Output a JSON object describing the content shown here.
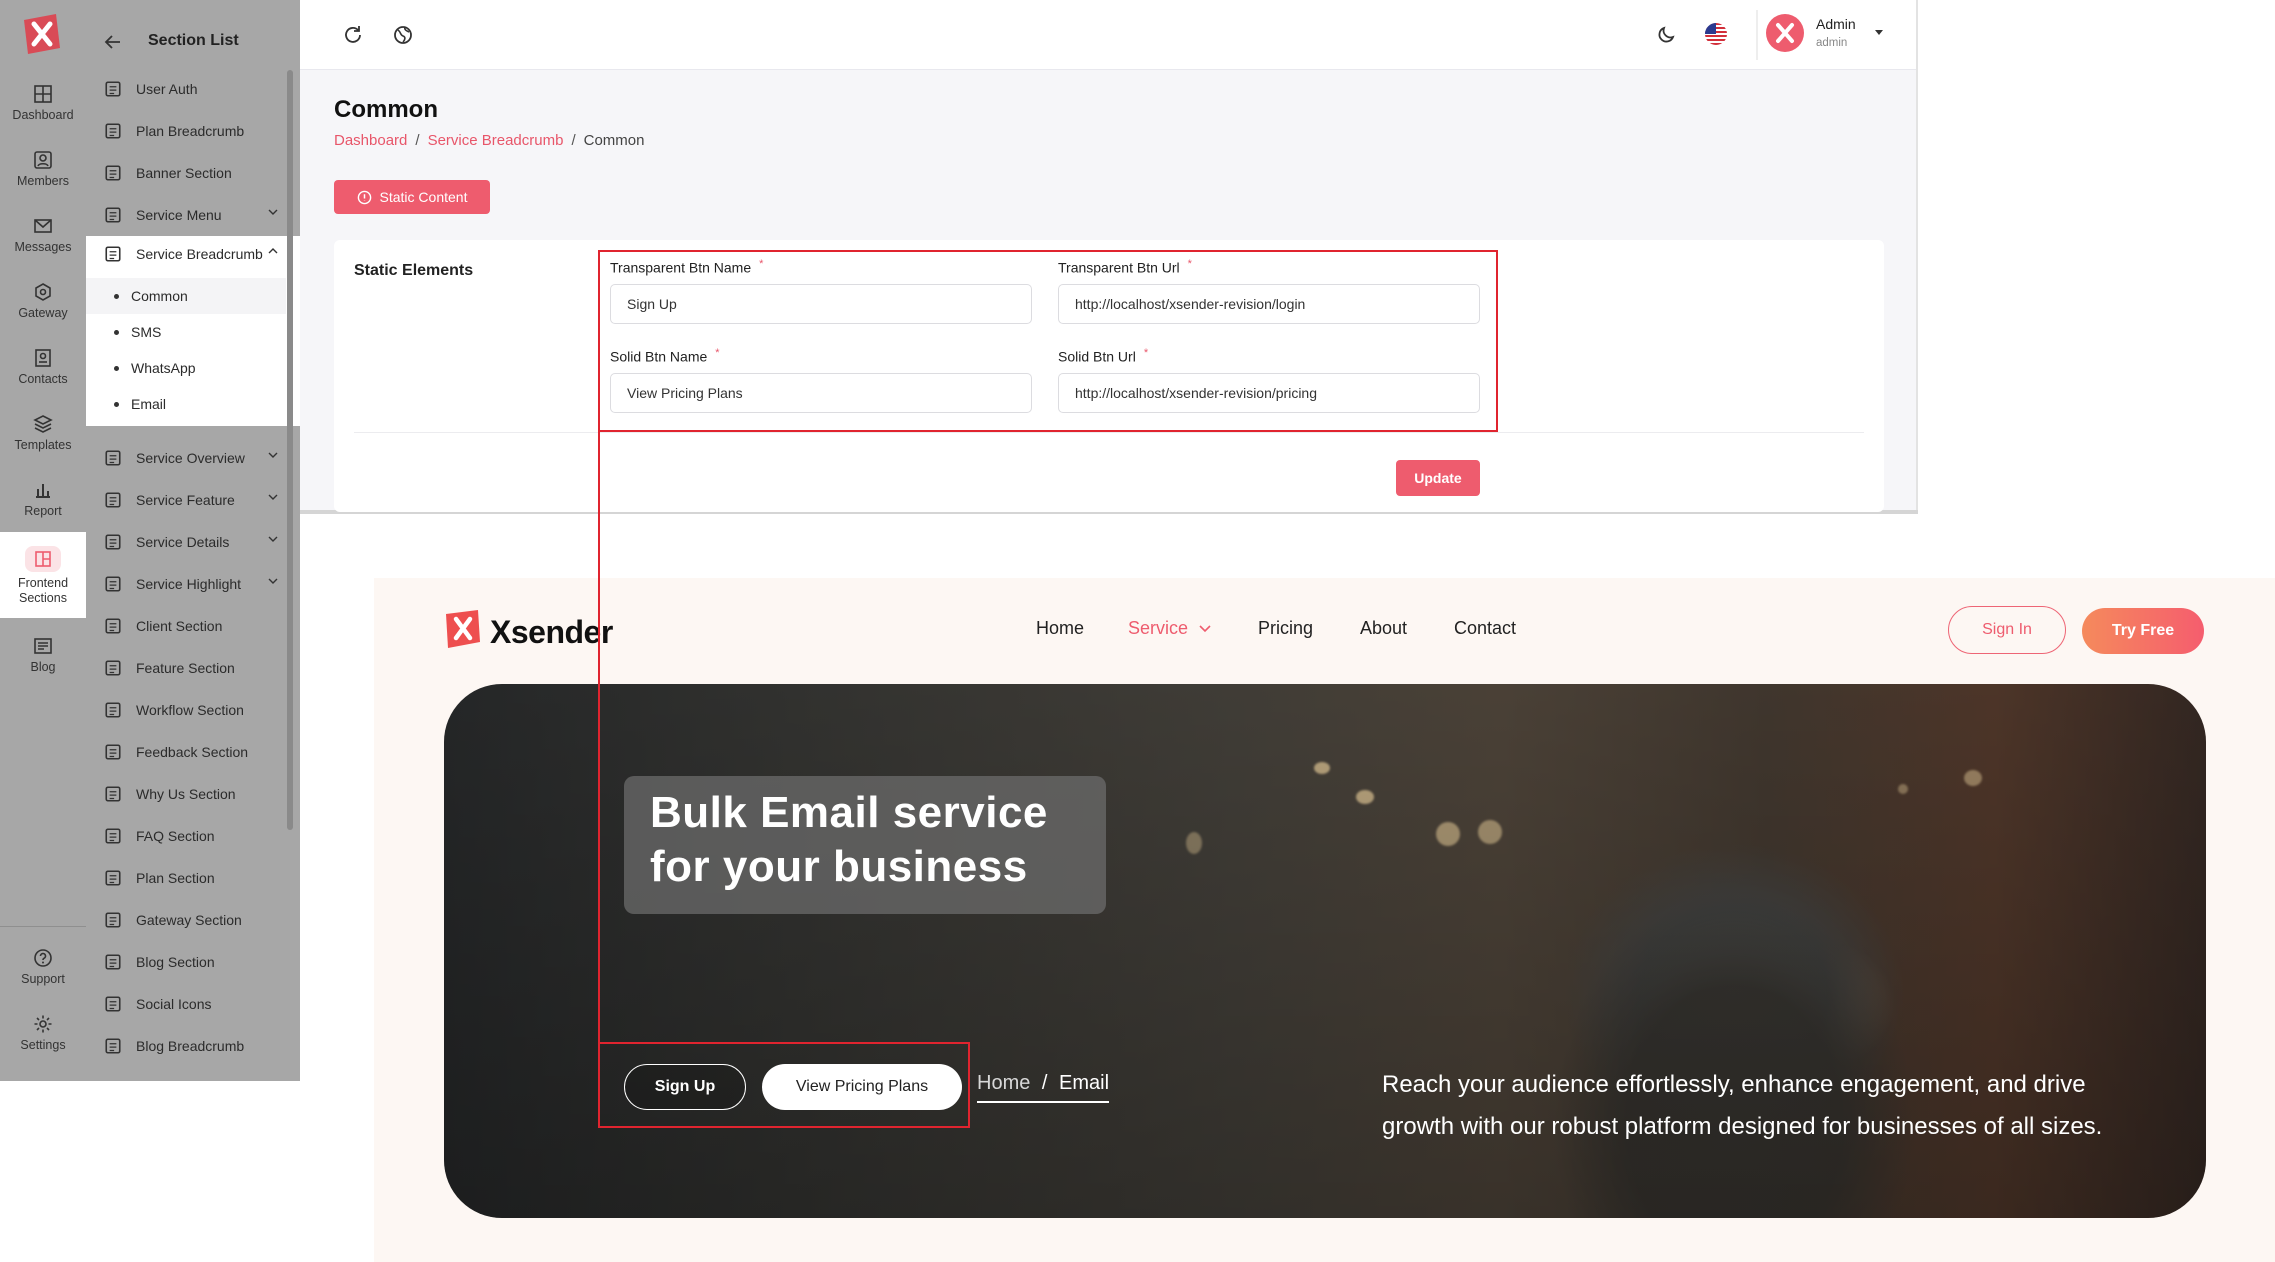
{
  "rail": {
    "items": [
      {
        "label": "Dashboard",
        "icon": "grid-icon"
      },
      {
        "label": "Members",
        "icon": "user-icon"
      },
      {
        "label": "Messages",
        "icon": "mail-icon"
      },
      {
        "label": "Gateway",
        "icon": "gateway-icon"
      },
      {
        "label": "Contacts",
        "icon": "contacts-icon"
      },
      {
        "label": "Templates",
        "icon": "layers-icon"
      },
      {
        "label": "Report",
        "icon": "bar-chart-icon"
      },
      {
        "label": "Frontend",
        "label2": "Sections",
        "icon": "layout-icon"
      },
      {
        "label": "Blog",
        "icon": "blog-icon"
      }
    ],
    "bottom": [
      {
        "label": "Support",
        "icon": "help-icon"
      },
      {
        "label": "Settings",
        "icon": "gear-icon"
      }
    ]
  },
  "section_list": {
    "title": "Section List",
    "items": [
      "User Auth",
      "Plan Breadcrumb",
      "Banner Section",
      "Service Menu",
      "Service Breadcrumb"
    ],
    "sub_items": [
      "Common",
      "SMS",
      "WhatsApp",
      "Email"
    ],
    "items_after": [
      "Service Overview",
      "Service Feature",
      "Service Details",
      "Service Highlight",
      "Client Section",
      "Feature Section",
      "Workflow Section",
      "Feedback Section",
      "Why Us Section",
      "FAQ Section",
      "Plan Section",
      "Gateway Section",
      "Blog Section",
      "Social Icons",
      "Blog Breadcrumb"
    ]
  },
  "topbar": {
    "user_name": "Admin",
    "user_role": "admin"
  },
  "page": {
    "title": "Common",
    "breadcrumb": [
      "Dashboard",
      "Service Breadcrumb",
      "Common"
    ],
    "static_button": "Static Content",
    "card_label": "Static Elements",
    "fields": {
      "transparent_btn_name_label": "Transparent Btn Name",
      "transparent_btn_name_value": "Sign Up",
      "transparent_btn_url_label": "Transparent Btn Url",
      "transparent_btn_url_value": "http://localhost/xsender-revision/login",
      "solid_btn_name_label": "Solid Btn Name",
      "solid_btn_name_value": "View Pricing Plans",
      "solid_btn_url_label": "Solid Btn Url",
      "solid_btn_url_value": "http://localhost/xsender-revision/pricing",
      "required_mark": "*"
    },
    "update_button": "Update"
  },
  "preview": {
    "brand": "Xsender",
    "nav": [
      "Home",
      "Service",
      "Pricing",
      "About",
      "Contact"
    ],
    "sign_in": "Sign In",
    "try_free": "Try Free",
    "hero_title": "Bulk Email service for your business",
    "btn_transparent": "Sign Up",
    "btn_solid": "View Pricing Plans",
    "crumb_home": "Home",
    "crumb_sep": "/",
    "crumb_current": "Email",
    "description": "Reach your audience effortlessly, enhance engagement, and drive growth with our robust platform designed for businesses of all sizes."
  },
  "colors": {
    "accent": "#ee5c6e",
    "highlight_box": "#e0242f",
    "sidebar_dim": "#a7a7a7"
  }
}
